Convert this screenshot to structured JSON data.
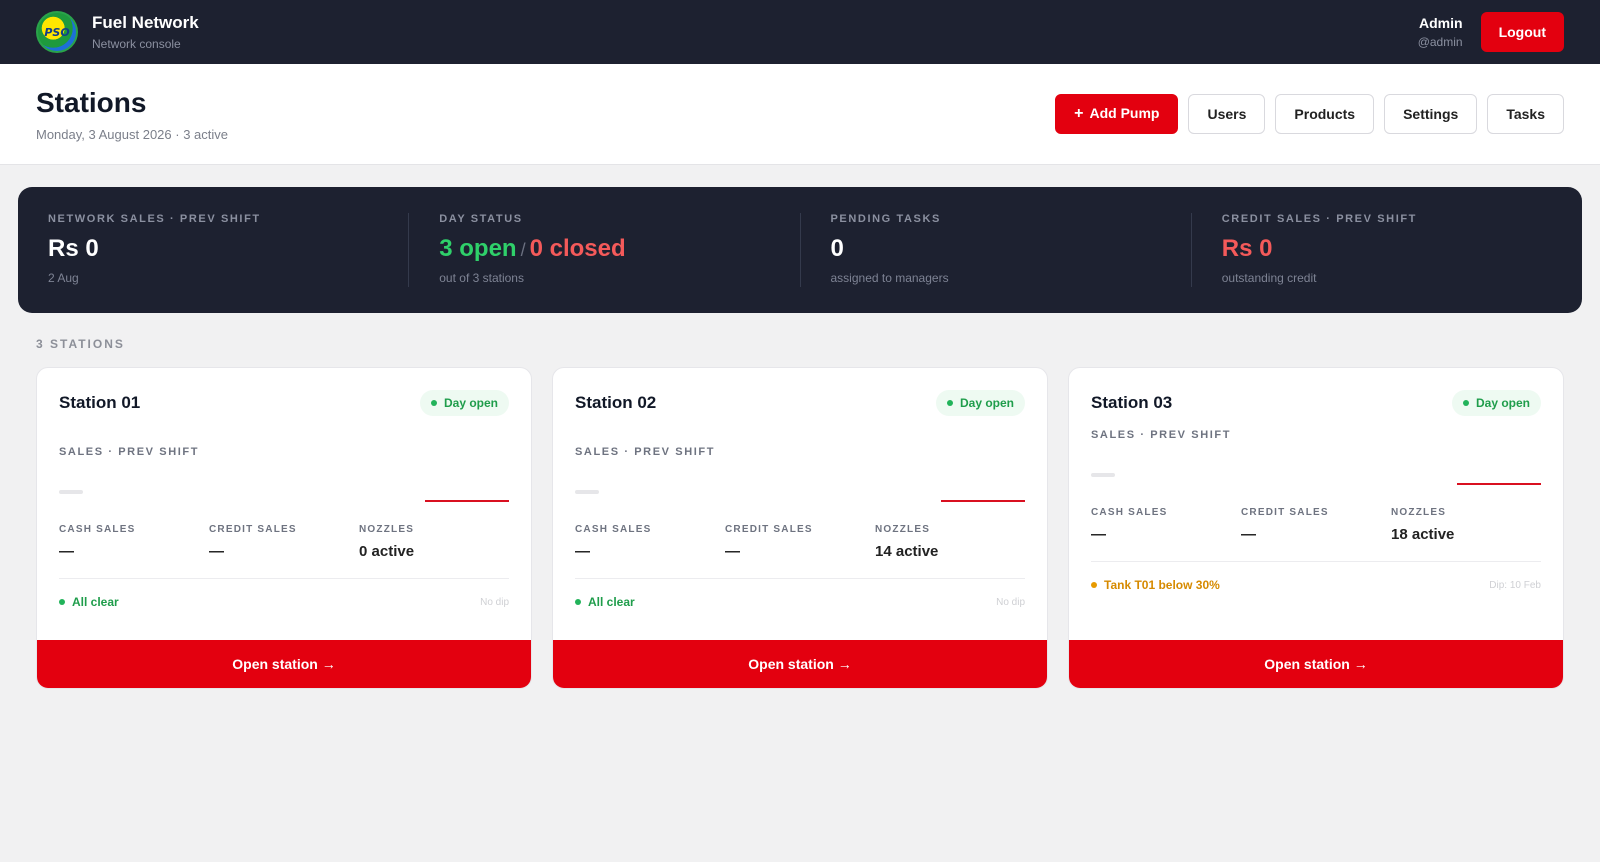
{
  "app": {
    "brand_name": "Fuel Network",
    "brand_sub": "Network console",
    "logo_text": "PSO",
    "user_name": "Admin",
    "user_handle": "@admin",
    "logout_label": "Logout"
  },
  "header": {
    "title": "Stations",
    "subtitle": "Monday, 3 August 2026 · 3 active",
    "add_pump_label": "Add Pump",
    "add_pump_icon": "+",
    "users_label": "Users",
    "products_label": "Products",
    "settings_label": "Settings",
    "tasks_label": "Tasks"
  },
  "summary": {
    "network_sales": {
      "label": "NETWORK SALES · PREV SHIFT",
      "value": "Rs 0",
      "foot": "2 Aug"
    },
    "day_status": {
      "label": "DAY STATUS",
      "open": "3 open",
      "separator": "/",
      "closed": "0 closed",
      "foot": "out of 3 stations"
    },
    "pending_tasks": {
      "label": "PENDING TASKS",
      "value": "0",
      "foot": "assigned to managers"
    },
    "credit_sales": {
      "label": "CREDIT SALES · PREV SHIFT",
      "value": "Rs 0",
      "foot": "outstanding credit"
    }
  },
  "stations_label": "3 STATIONS",
  "stations": [
    {
      "name": "Station 01",
      "badge": "Day open",
      "sales_label": "SALES · PREV SHIFT",
      "cash_label": "CASH SALES",
      "cash_value": "—",
      "credit_label": "CREDIT SALES",
      "credit_value": "—",
      "nozzles_label": "NOZZLES",
      "nozzles_value": "0 active",
      "status": "All clear",
      "dip": "No dip",
      "cta": "Open station →"
    },
    {
      "name": "Station 02",
      "badge": "Day open",
      "sales_label": "SALES · PREV SHIFT",
      "cash_label": "CASH SALES",
      "cash_value": "—",
      "credit_label": "CREDIT SALES",
      "credit_value": "—",
      "nozzles_label": "NOZZLES",
      "nozzles_value": "14 active",
      "status": "All clear",
      "dip": "No dip",
      "cta": "Open station →"
    },
    {
      "name": "Station 03",
      "badge": "Day open",
      "sales_label": "SALES · PREV SHIFT",
      "cash_label": "CASH SALES",
      "cash_value": "—",
      "credit_label": "CREDIT SALES",
      "credit_value": "—",
      "nozzles_label": "NOZZLES",
      "nozzles_value": "18 active",
      "status": "Tank T01 below 30%",
      "dip": "Dip: 10 Feb",
      "cta": "Open station →"
    }
  ],
  "colors": {
    "brand_red": "#e3000f",
    "navy": "#1d2130",
    "success_green": "#1f9d4b",
    "warning_amber": "#d68a00",
    "danger_red": "#f45a5a"
  }
}
